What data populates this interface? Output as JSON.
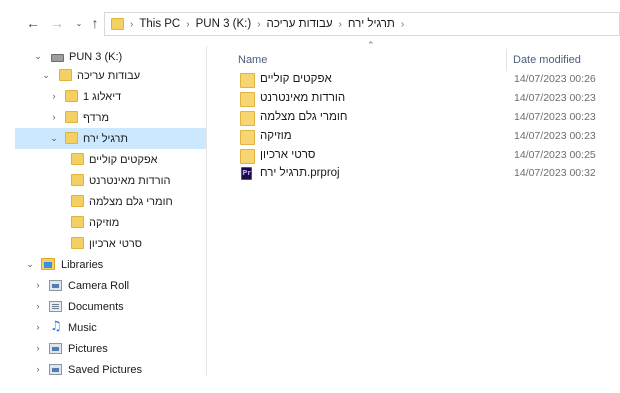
{
  "toolbar": {
    "back_icon": "arrow-left-icon",
    "forward_icon": "arrow-right-icon",
    "recent_icon": "chevron-down-icon",
    "up_icon": "arrow-up-icon"
  },
  "address": {
    "crumbs": [
      "This PC",
      "PUN 3 (K:)",
      "עבודות עריכה",
      "תרגיל ירח"
    ]
  },
  "tree": {
    "items": [
      {
        "label": "PUN 3 (K:)",
        "icon": "drive-icon",
        "expanded": true
      },
      {
        "label": "עבודות עריכה",
        "icon": "folder-icon",
        "expanded": true
      },
      {
        "label": "דיאלוג 1",
        "icon": "folder-icon",
        "expanded": false
      },
      {
        "label": "מרדף",
        "icon": "folder-icon",
        "expanded": false
      },
      {
        "label": "תרגיל ירח",
        "icon": "folder-icon",
        "expanded": true,
        "selected": true
      },
      {
        "label": "אפקטים קוליים",
        "icon": "folder-icon"
      },
      {
        "label": "הורדות מאינטרנט",
        "icon": "folder-icon"
      },
      {
        "label": "חומרי גלם מצלמה",
        "icon": "folder-icon"
      },
      {
        "label": "מוזיקה",
        "icon": "folder-icon"
      },
      {
        "label": "סרטי ארכיון",
        "icon": "folder-icon"
      },
      {
        "label": "Libraries",
        "icon": "libraries-icon",
        "expanded": true
      },
      {
        "label": "Camera Roll",
        "icon": "pictures-library-icon",
        "expanded": false
      },
      {
        "label": "Documents",
        "icon": "documents-library-icon",
        "expanded": false
      },
      {
        "label": "Music",
        "icon": "music-library-icon",
        "expanded": false
      },
      {
        "label": "Pictures",
        "icon": "pictures-library-icon",
        "expanded": false
      },
      {
        "label": "Saved Pictures",
        "icon": "pictures-library-icon",
        "expanded": false
      }
    ]
  },
  "list": {
    "columns": {
      "name": "Name",
      "date": "Date modified"
    },
    "files": [
      {
        "name": "אפקטים קוליים",
        "date": "14/07/2023 00:26",
        "icon": "folder-icon"
      },
      {
        "name": "הורדות מאינטרנט",
        "date": "14/07/2023 00:23",
        "icon": "folder-icon"
      },
      {
        "name": "חומרי גלם מצלמה",
        "date": "14/07/2023 00:23",
        "icon": "folder-icon"
      },
      {
        "name": "מוזיקה",
        "date": "14/07/2023 00:23",
        "icon": "folder-icon"
      },
      {
        "name": "סרטי ארכיון",
        "date": "14/07/2023 00:25",
        "icon": "folder-icon"
      },
      {
        "name": "תרגיל ירח.prproj",
        "date": "14/07/2023 00:32",
        "icon": "premiere-project-icon"
      }
    ]
  },
  "colors": {
    "selection": "#cce8ff",
    "folder": "#f4cf63",
    "header_text": "#4c607a"
  }
}
